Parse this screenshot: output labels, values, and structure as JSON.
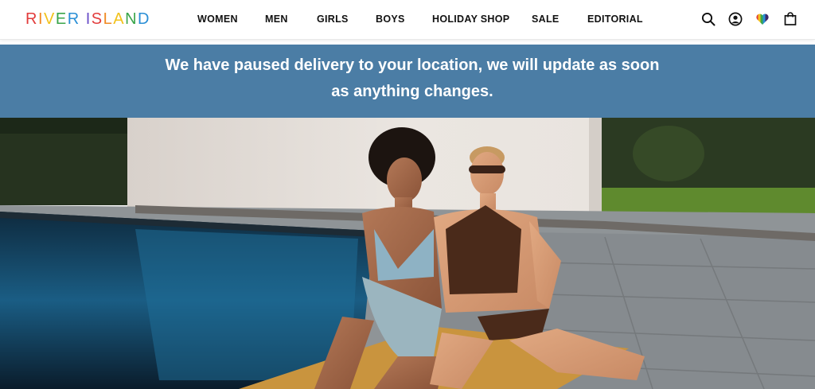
{
  "brand": {
    "name": "RIVER ISLAND",
    "letter_colors": [
      "#e23c3c",
      "#f08a24",
      "#f2c21b",
      "#3aa54a",
      "#2a8fd6",
      "#6b4fc8",
      "#e23c3c",
      "#f08a24",
      "#f2c21b",
      "#3aa54a",
      "#2a8fd6",
      "#6b4fc8"
    ]
  },
  "nav": {
    "items": [
      {
        "label": "WOMEN"
      },
      {
        "label": "MEN"
      },
      {
        "label": "GIRLS"
      },
      {
        "label": "BOYS"
      },
      {
        "label": "HOLIDAY SHOP"
      },
      {
        "label": "SALE"
      },
      {
        "label": "EDITORIAL"
      }
    ]
  },
  "header_icons": [
    "search-icon",
    "account-icon",
    "pride-heart-icon",
    "bag-icon"
  ],
  "banner": {
    "message": "We have paused delivery to your location, we will update as soon as anything changes.",
    "background": "#4b7da5",
    "text_color": "#ffffff"
  },
  "hero": {
    "image": "two-models-swimwear-poolside"
  }
}
